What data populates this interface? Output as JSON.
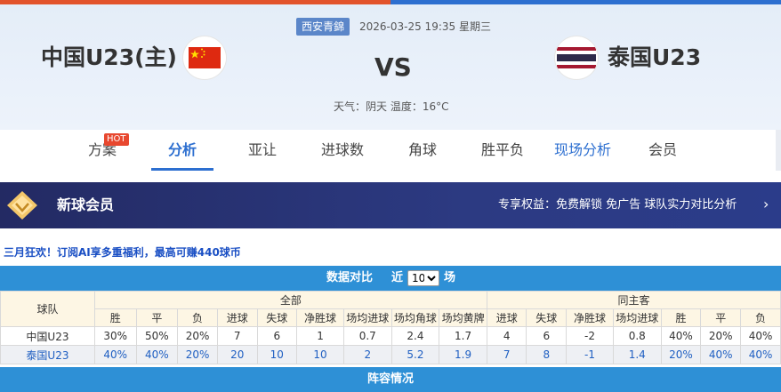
{
  "match": {
    "league": "西安青錦",
    "datetime": "2026-03-25 19:35 星期三",
    "home_team": "中国U23(主)",
    "away_team": "泰国U23",
    "vs": "VS",
    "weather": "天气：阴天 温度：16°C",
    "home_flag": "china-flag",
    "away_flag": "thailand-flag"
  },
  "tabs": [
    {
      "label": "方案",
      "badge": "HOT"
    },
    {
      "label": "分析",
      "active": true
    },
    {
      "label": "亚让"
    },
    {
      "label": "进球数"
    },
    {
      "label": "角球"
    },
    {
      "label": "胜平负"
    },
    {
      "label": "现场分析",
      "highlight": true
    },
    {
      "label": "会员"
    }
  ],
  "member": {
    "title": "新球会员",
    "benefit": "专享权益：免费解锁 免广告 球队实力对比分析",
    "arrow": "›"
  },
  "promo": "三月狂欢！订阅AI享多重福利，最高可赚440球币",
  "stats": {
    "title": "数据对比",
    "near_label": "近",
    "selected_count": "10",
    "unit": "场",
    "team_col": "球队",
    "group_all": "全部",
    "group_same": "同主客",
    "columns": [
      "胜",
      "平",
      "负",
      "进球",
      "失球",
      "净胜球",
      "场均进球",
      "场均角球",
      "场均黄牌",
      "进球",
      "失球",
      "净胜球",
      "场均进球",
      "胜",
      "平",
      "负"
    ],
    "rows": [
      {
        "team": "中国U23",
        "values": [
          "30%",
          "50%",
          "20%",
          "7",
          "6",
          "1",
          "0.7",
          "2.4",
          "1.7",
          "4",
          "6",
          "-2",
          "0.8",
          "40%",
          "20%",
          "40%"
        ]
      },
      {
        "team": "泰国U23",
        "values": [
          "40%",
          "40%",
          "20%",
          "20",
          "10",
          "10",
          "2",
          "5.2",
          "1.9",
          "7",
          "8",
          "-1",
          "1.4",
          "20%",
          "40%",
          "40%"
        ]
      }
    ]
  },
  "lineup": {
    "title": "阵容情况"
  },
  "colors": {
    "brand_blue": "#2d6fd0",
    "table_header_blue": "#2e90d6",
    "hot_red": "#e8482f",
    "member_bg": "#2c3a82"
  }
}
